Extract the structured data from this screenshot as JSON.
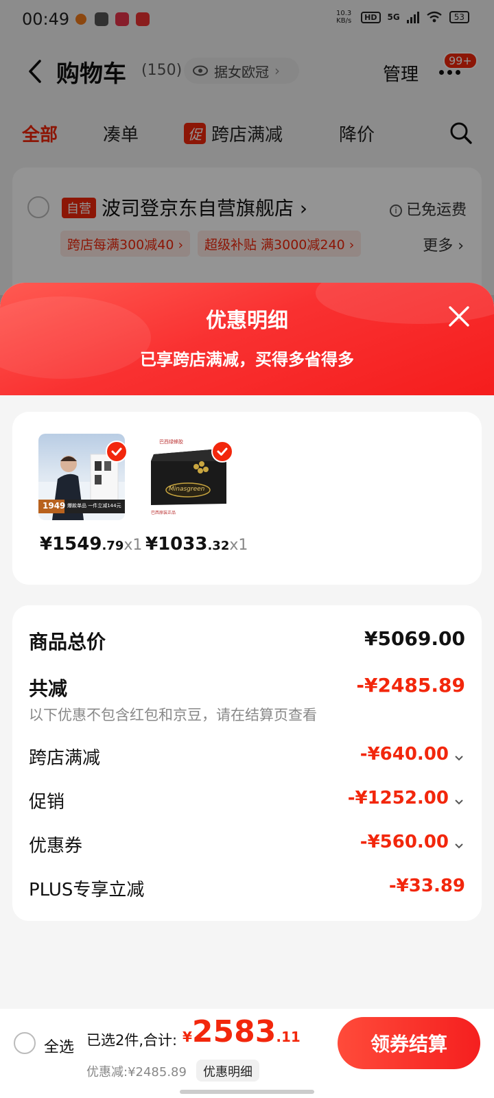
{
  "status_bar": {
    "time": "00:49",
    "net_speed": "10.3 KB/s",
    "hd": "HD",
    "network": "5G",
    "battery": "53"
  },
  "nav": {
    "title": "购物车",
    "count": "(150)",
    "location": "据女欧冠",
    "manage": "管理",
    "badge": "99+"
  },
  "tabs": {
    "all": "全部",
    "bundle": "凑单",
    "promo_tag": "促",
    "cross_store": "跨店满减",
    "price_drop": "降价"
  },
  "store": {
    "self_tag": "自营",
    "name": "波司登京东自营旗舰店",
    "shipping": "已免运费",
    "coupon1": "跨店每满300减40",
    "coupon2": "超级补贴 满3000减240",
    "more": "更多"
  },
  "sheet": {
    "title": "优惠明细",
    "subtitle": "已享跨店满减，买得多省得多"
  },
  "items": [
    {
      "price_int": "¥1549",
      "price_dec": ".79",
      "qty": "x1",
      "banner": "1949",
      "caption": "爆款单品 一件立减144元"
    },
    {
      "price_int": "¥1033",
      "price_dec": ".32",
      "qty": "x1",
      "brand": "Minasgreen",
      "caption": "巴西原装正品"
    }
  ],
  "summary": {
    "total_label": "商品总价",
    "total_value": "¥5069.00",
    "reduce_label": "共减",
    "reduce_value": "-¥2485.89",
    "note": "以下优惠不包含红包和京豆，请在结算页查看",
    "rows": [
      {
        "label": "跨店满减",
        "value": "-¥640.00"
      },
      {
        "label": "促销",
        "value": "-¥1252.00"
      },
      {
        "label": "优惠券",
        "value": "-¥560.00"
      },
      {
        "label": "PLUS专享立减",
        "value": "-¥33.89"
      }
    ]
  },
  "bottom": {
    "select_all": "全选",
    "selected": "已选2件,合计:",
    "yen": "¥",
    "total_int": "2583",
    "total_dec": ".11",
    "discount": "优惠减:¥2485.89",
    "detail": "优惠明细",
    "checkout": "领券结算"
  },
  "colors": {
    "accent": "#f2270c",
    "sheet_header": "#f93131"
  }
}
